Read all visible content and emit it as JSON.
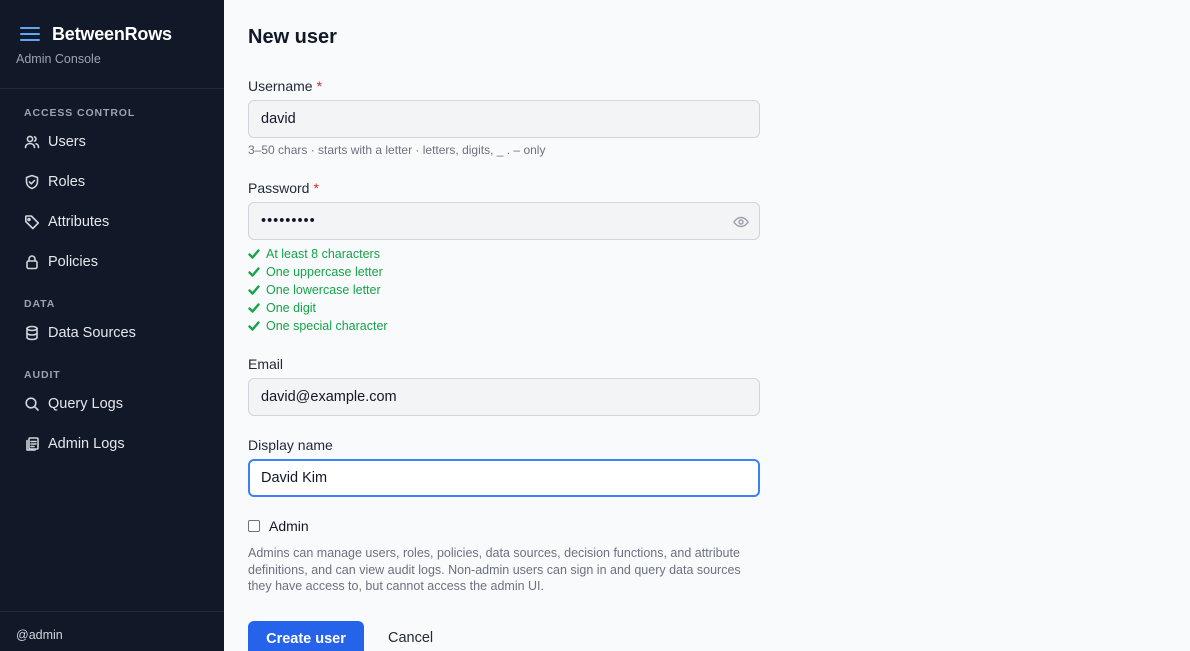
{
  "app": {
    "name": "BetweenRows",
    "subtitle": "Admin Console",
    "accent": "#2563eb"
  },
  "sidebar": {
    "sections": [
      {
        "label": "ACCESS CONTROL",
        "items": [
          {
            "label": "Users",
            "icon": "users-icon"
          },
          {
            "label": "Roles",
            "icon": "shield-icon"
          },
          {
            "label": "Attributes",
            "icon": "tag-icon"
          },
          {
            "label": "Policies",
            "icon": "lock-icon"
          }
        ]
      },
      {
        "label": "DATA",
        "items": [
          {
            "label": "Data Sources",
            "icon": "database-icon"
          }
        ]
      },
      {
        "label": "AUDIT",
        "items": [
          {
            "label": "Query Logs",
            "icon": "search-icon"
          },
          {
            "label": "Admin Logs",
            "icon": "clipboard-icon"
          }
        ]
      }
    ],
    "footer_user": "@admin"
  },
  "form": {
    "title": "New user",
    "username": {
      "label": "Username",
      "required_mark": "*",
      "value": "david",
      "hint": "3–50 chars · starts with a letter · letters, digits, _ . – only"
    },
    "password": {
      "label": "Password",
      "required_mark": "*",
      "value": "•••••••••",
      "rules": [
        "At least 8 characters",
        "One uppercase letter",
        "One lowercase letter",
        "One digit",
        "One special character"
      ]
    },
    "email": {
      "label": "Email",
      "value": "david@example.com"
    },
    "display_name": {
      "label": "Display name",
      "value": "David Kim"
    },
    "admin": {
      "label": "Admin",
      "checked": false,
      "description": "Admins can manage users, roles, policies, data sources, decision functions, and attribute definitions, and can view audit logs. Non-admin users can sign in and query data sources they have access to, but cannot access the admin UI."
    },
    "submit_label": "Create user",
    "cancel_label": "Cancel"
  }
}
